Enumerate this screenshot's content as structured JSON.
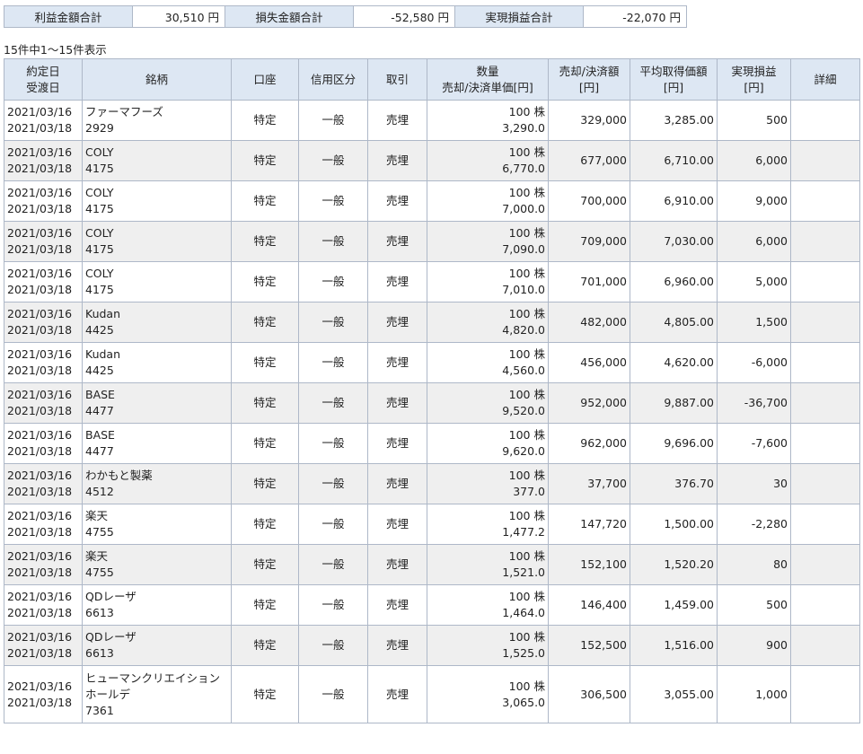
{
  "summary": {
    "profit_label": "利益金額合計",
    "profit_value": "30,510 円",
    "loss_label": "損失金額合計",
    "loss_value": "-52,580 円",
    "realized_label": "実現損益合計",
    "realized_value": "-22,070 円"
  },
  "count_text": "15件中1～15件表示",
  "headers": {
    "date_contract": "約定日",
    "date_delivery": "受渡日",
    "brand": "銘柄",
    "account": "口座",
    "credit": "信用区分",
    "trade": "取引",
    "qty_line1": "数量",
    "qty_line2": "売却/決済単価[円]",
    "amount_line1": "売却/決済額",
    "amount_line2": "[円]",
    "avg_line1": "平均取得価額",
    "avg_line2": "[円]",
    "pl_line1": "実現損益",
    "pl_line2": "[円]",
    "detail": "詳細"
  },
  "rows": [
    {
      "contract": "2021/03/16",
      "delivery": "2021/03/18",
      "name": "ファーマフーズ",
      "code": "2929",
      "account": "特定",
      "credit": "一般",
      "trade": "売埋",
      "qty": "100 株",
      "price": "3,290.0",
      "amount": "329,000",
      "avg": "3,285.00",
      "pl": "500",
      "detail": ""
    },
    {
      "contract": "2021/03/16",
      "delivery": "2021/03/18",
      "name": "COLY",
      "code": "4175",
      "account": "特定",
      "credit": "一般",
      "trade": "売埋",
      "qty": "100 株",
      "price": "6,770.0",
      "amount": "677,000",
      "avg": "6,710.00",
      "pl": "6,000",
      "detail": ""
    },
    {
      "contract": "2021/03/16",
      "delivery": "2021/03/18",
      "name": "COLY",
      "code": "4175",
      "account": "特定",
      "credit": "一般",
      "trade": "売埋",
      "qty": "100 株",
      "price": "7,000.0",
      "amount": "700,000",
      "avg": "6,910.00",
      "pl": "9,000",
      "detail": ""
    },
    {
      "contract": "2021/03/16",
      "delivery": "2021/03/18",
      "name": "COLY",
      "code": "4175",
      "account": "特定",
      "credit": "一般",
      "trade": "売埋",
      "qty": "100 株",
      "price": "7,090.0",
      "amount": "709,000",
      "avg": "7,030.00",
      "pl": "6,000",
      "detail": ""
    },
    {
      "contract": "2021/03/16",
      "delivery": "2021/03/18",
      "name": "COLY",
      "code": "4175",
      "account": "特定",
      "credit": "一般",
      "trade": "売埋",
      "qty": "100 株",
      "price": "7,010.0",
      "amount": "701,000",
      "avg": "6,960.00",
      "pl": "5,000",
      "detail": ""
    },
    {
      "contract": "2021/03/16",
      "delivery": "2021/03/18",
      "name": "Kudan",
      "code": "4425",
      "account": "特定",
      "credit": "一般",
      "trade": "売埋",
      "qty": "100 株",
      "price": "4,820.0",
      "amount": "482,000",
      "avg": "4,805.00",
      "pl": "1,500",
      "detail": ""
    },
    {
      "contract": "2021/03/16",
      "delivery": "2021/03/18",
      "name": "Kudan",
      "code": "4425",
      "account": "特定",
      "credit": "一般",
      "trade": "売埋",
      "qty": "100 株",
      "price": "4,560.0",
      "amount": "456,000",
      "avg": "4,620.00",
      "pl": "-6,000",
      "detail": ""
    },
    {
      "contract": "2021/03/16",
      "delivery": "2021/03/18",
      "name": "BASE",
      "code": "4477",
      "account": "特定",
      "credit": "一般",
      "trade": "売埋",
      "qty": "100 株",
      "price": "9,520.0",
      "amount": "952,000",
      "avg": "9,887.00",
      "pl": "-36,700",
      "detail": ""
    },
    {
      "contract": "2021/03/16",
      "delivery": "2021/03/18",
      "name": "BASE",
      "code": "4477",
      "account": "特定",
      "credit": "一般",
      "trade": "売埋",
      "qty": "100 株",
      "price": "9,620.0",
      "amount": "962,000",
      "avg": "9,696.00",
      "pl": "-7,600",
      "detail": ""
    },
    {
      "contract": "2021/03/16",
      "delivery": "2021/03/18",
      "name": "わかもと製薬",
      "code": "4512",
      "account": "特定",
      "credit": "一般",
      "trade": "売埋",
      "qty": "100 株",
      "price": "377.0",
      "amount": "37,700",
      "avg": "376.70",
      "pl": "30",
      "detail": ""
    },
    {
      "contract": "2021/03/16",
      "delivery": "2021/03/18",
      "name": "楽天",
      "code": "4755",
      "account": "特定",
      "credit": "一般",
      "trade": "売埋",
      "qty": "100 株",
      "price": "1,477.2",
      "amount": "147,720",
      "avg": "1,500.00",
      "pl": "-2,280",
      "detail": ""
    },
    {
      "contract": "2021/03/16",
      "delivery": "2021/03/18",
      "name": "楽天",
      "code": "4755",
      "account": "特定",
      "credit": "一般",
      "trade": "売埋",
      "qty": "100 株",
      "price": "1,521.0",
      "amount": "152,100",
      "avg": "1,520.20",
      "pl": "80",
      "detail": ""
    },
    {
      "contract": "2021/03/16",
      "delivery": "2021/03/18",
      "name": "QDレーザ",
      "code": "6613",
      "account": "特定",
      "credit": "一般",
      "trade": "売埋",
      "qty": "100 株",
      "price": "1,464.0",
      "amount": "146,400",
      "avg": "1,459.00",
      "pl": "500",
      "detail": ""
    },
    {
      "contract": "2021/03/16",
      "delivery": "2021/03/18",
      "name": "QDレーザ",
      "code": "6613",
      "account": "特定",
      "credit": "一般",
      "trade": "売埋",
      "qty": "100 株",
      "price": "1,525.0",
      "amount": "152,500",
      "avg": "1,516.00",
      "pl": "900",
      "detail": ""
    },
    {
      "contract": "2021/03/16",
      "delivery": "2021/03/18",
      "name": "ヒューマンクリエイション",
      "name2": "ホールデ",
      "code": "7361",
      "account": "特定",
      "credit": "一般",
      "trade": "売埋",
      "qty": "100 株",
      "price": "3,065.0",
      "amount": "306,500",
      "avg": "3,055.00",
      "pl": "1,000",
      "detail": ""
    }
  ]
}
